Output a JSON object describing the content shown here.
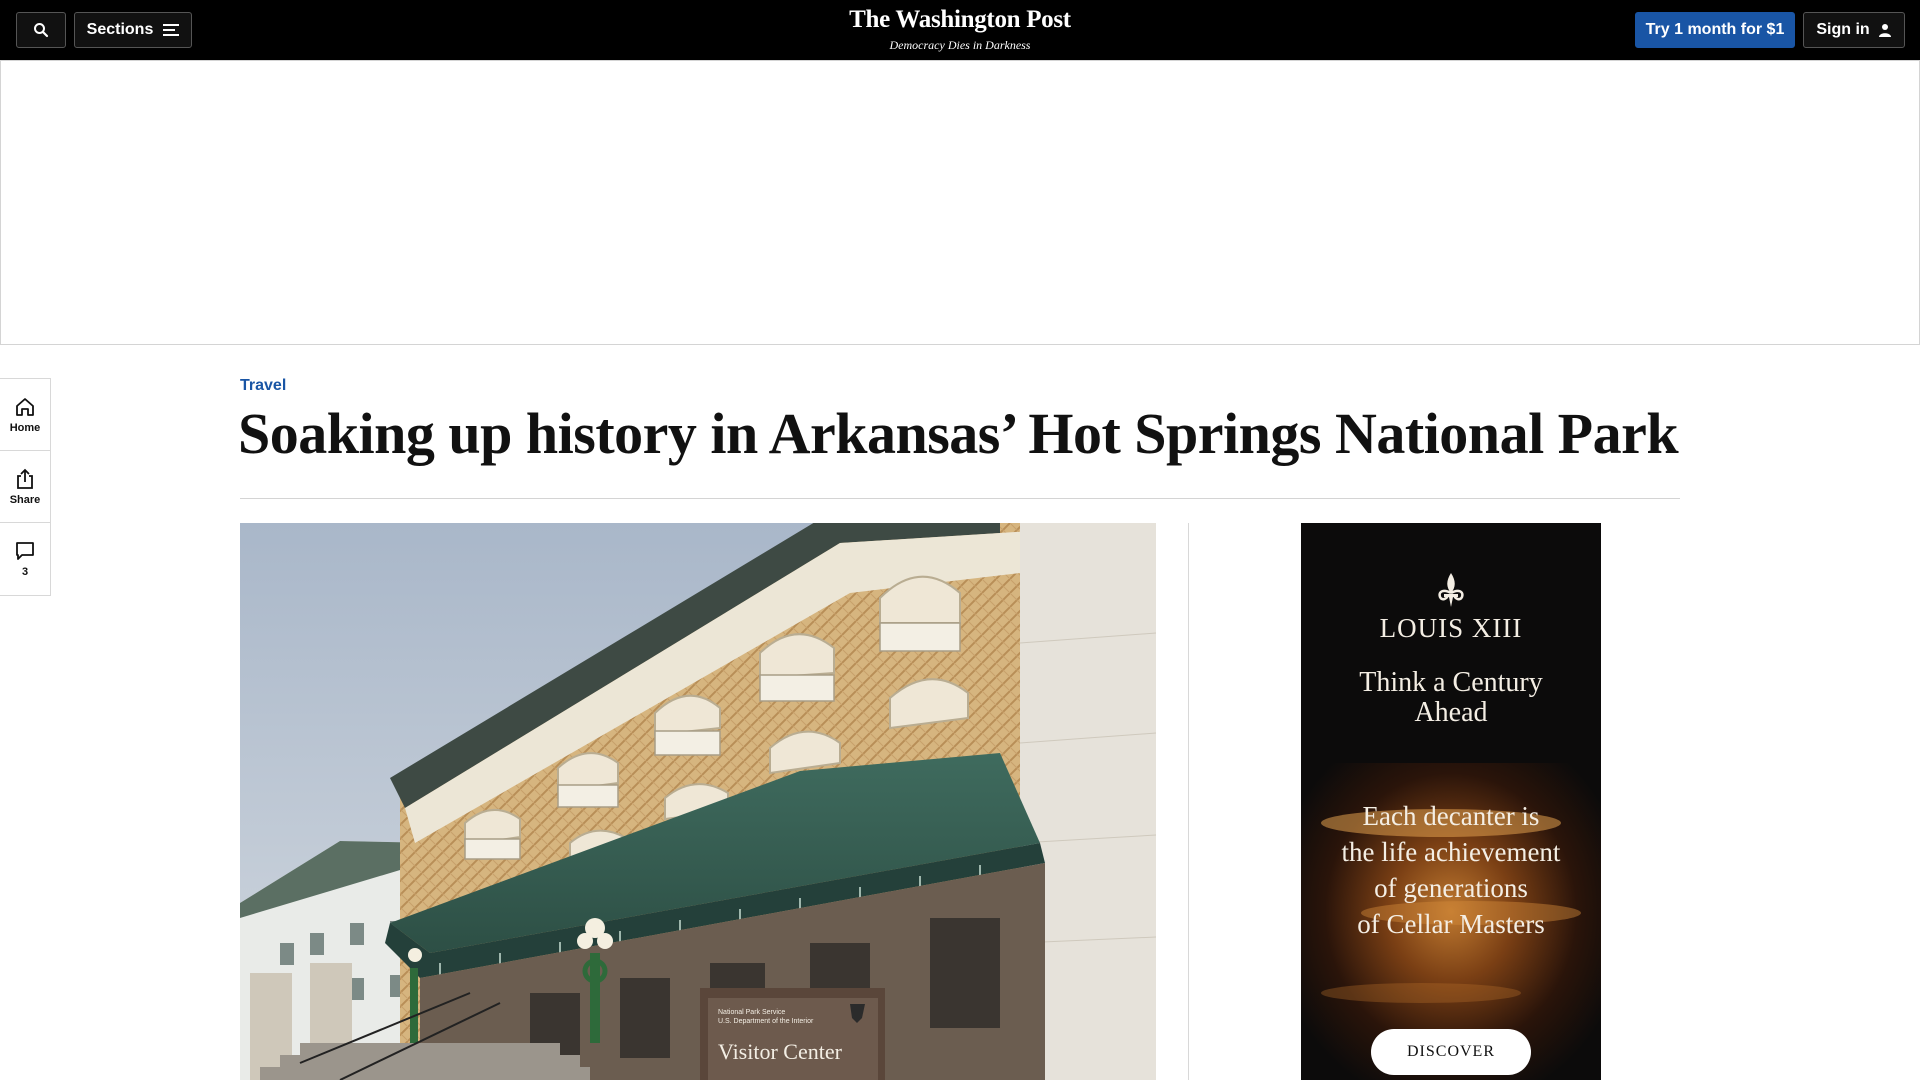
{
  "header": {
    "sections_label": "Sections",
    "logo_title": "The Washington Post",
    "logo_tagline": "Democracy Dies in Darkness",
    "subscribe_label": "Try 1 month for $1",
    "signin_label": "Sign in",
    "icons": [
      "search-icon",
      "menu-icon",
      "user-icon"
    ]
  },
  "rail": {
    "home_label": "Home",
    "share_label": "Share",
    "comments_count": "3",
    "icons": [
      "home-icon",
      "share-icon",
      "comment-icon"
    ]
  },
  "article": {
    "kicker": "Travel",
    "headline": "Soaking up history in Arkansas’ Hot Springs National Park",
    "image_sign_agency": "National Park Service",
    "image_sign_department": "U.S. Department of the Interior",
    "image_sign_title": "Visitor Center"
  },
  "side_ad": {
    "brand": "LOUIS XIII",
    "tagline": "Think a Century Ahead",
    "body_lines": [
      "Each decanter is",
      "the life achievement",
      "of generations",
      "of Cellar Masters"
    ],
    "cta": "DISCOVER"
  },
  "colors": {
    "accent_blue": "#1955a5",
    "topbar_bg": "#000000",
    "ad_bg": "#0c0b0b"
  }
}
